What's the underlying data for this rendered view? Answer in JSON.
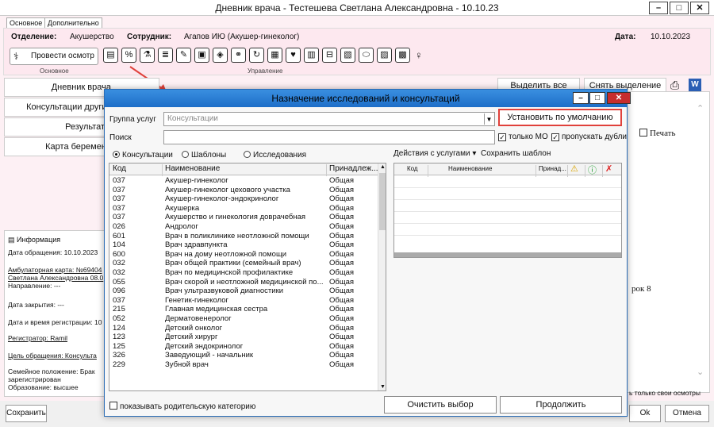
{
  "window": {
    "title": "Дневник врача - Тестешева Светлана Александровна - 10.10.23"
  },
  "tabs": [
    "Основное",
    "Дополнительно"
  ],
  "header": {
    "department_label": "Отделение:",
    "department_value": "Акушерство",
    "staff_label": "Сотрудник:",
    "staff_value": "Агапов ИЮ (Акушер-гинеколог)",
    "date_label": "Дата:",
    "date_value": "10.10.2023",
    "exam_button": "Провести осмотр",
    "section_main": "Основное",
    "section_manage": "Управление"
  },
  "sidebar": {
    "items": [
      "Дневник врача",
      "Консультации других",
      "Результаты",
      "Карта беременн"
    ]
  },
  "info": {
    "title": "Информация",
    "lines": [
      "Дата обращения: 10.10.2023",
      "Амбулаторная карта: №69404",
      "Светлана Александровна 08.0",
      "Направление: ---",
      "Дата закрытия: ---",
      "Дата и время регистрации: 10",
      "Регистратор: Ramil",
      "Цель обращения: Консульта",
      "Семейное положение: Брак",
      "зарегистрирован",
      "Образование: высшее"
    ]
  },
  "right": {
    "select_all": "Выделить все",
    "deselect": "Снять выделение",
    "print_label": "Печать",
    "fragment": "рок 8",
    "only_mine": "ь только свои осмотры"
  },
  "bottom": {
    "save": "Сохранить",
    "ok": "Ok",
    "cancel": "Отмена"
  },
  "dialog": {
    "title": "Назначение исследований и консультаций",
    "group_label": "Группа услуг",
    "group_value": "Консультации",
    "default_button": "Установить по умолчанию",
    "search_label": "Поиск",
    "only_mo": "только МО",
    "skip_dups": "пропускать дубли",
    "radios": [
      "Консультации",
      "Шаблоны",
      "Исследования"
    ],
    "actions": "Действия с услугами ▾",
    "save_template": "Сохранить шаблон",
    "list_headers": [
      "Код",
      "Наименование",
      "Принадлеж..."
    ],
    "rows": [
      [
        "037",
        "Акушер-гинеколог",
        "Общая"
      ],
      [
        "037",
        "Акушер-гинеколог цехового участка",
        "Общая"
      ],
      [
        "037",
        "Акушер-гинеколог-эндокринолог",
        "Общая"
      ],
      [
        "037",
        "Акушерка",
        "Общая"
      ],
      [
        "037",
        "Акушерство и гинекология доврачебная",
        "Общая"
      ],
      [
        "026",
        "Андролог",
        "Общая"
      ],
      [
        "601",
        "Врач в поликлинике неотложной помощи",
        "Общая"
      ],
      [
        "104",
        "Врач здравпункта",
        "Общая"
      ],
      [
        "600",
        "Врач на дому неотложной помощи",
        "Общая"
      ],
      [
        "032",
        "Врач общей практики (семейный врач)",
        "Общая"
      ],
      [
        "032",
        "Врач по медицинской профилактике",
        "Общая"
      ],
      [
        "055",
        "Врач скорой и неотложной медицинской по...",
        "Общая"
      ],
      [
        "096",
        "Врач ультразвуковой диагностики",
        "Общая"
      ],
      [
        "037",
        "Генетик-гинеколог",
        "Общая"
      ],
      [
        "215",
        "Главная медицинская сестра",
        "Общая"
      ],
      [
        "052",
        "Дерматовенеролог",
        "Общая"
      ],
      [
        "124",
        "Детский онколог",
        "Общая"
      ],
      [
        "123",
        "Детский хирург",
        "Общая"
      ],
      [
        "125",
        "Детский эндокринолог",
        "Общая"
      ],
      [
        "326",
        "Заведующий - начальник",
        "Общая"
      ],
      [
        "229",
        "Зубной врач",
        "Общая"
      ]
    ],
    "grid2_headers": [
      "Код",
      "Наименование",
      "Принад..."
    ],
    "show_parent": "показывать родительскую категорию",
    "clear": "Очистить выбор",
    "continue": "Продолжить"
  }
}
